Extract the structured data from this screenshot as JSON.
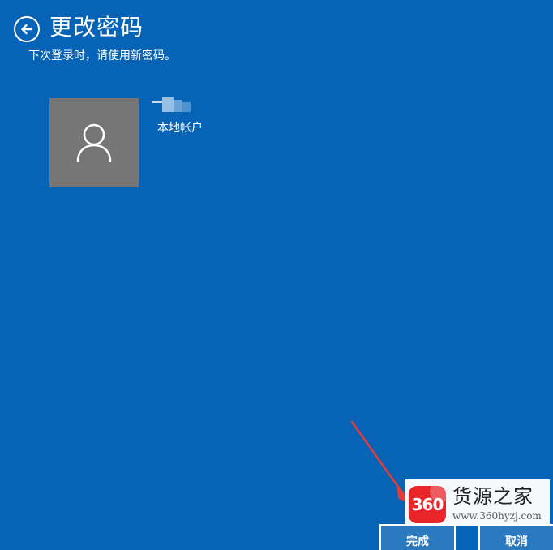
{
  "header": {
    "title": "更改密码",
    "subtitle": "下次登录时，请使用新密码。",
    "back_icon": "back-arrow-icon"
  },
  "account": {
    "name": "",
    "type": "本地帐户",
    "avatar_icon": "user-icon",
    "avatar_color": "#767676"
  },
  "buttons": {
    "finish": "完成",
    "cancel": "取消"
  },
  "watermark": {
    "logo_text": "360",
    "name": "货源之家",
    "url": "www.360hyzj.com"
  },
  "colors": {
    "background": "#0663B6",
    "annotation_arrow": "#E23B3B",
    "logo": "#E8262A"
  }
}
